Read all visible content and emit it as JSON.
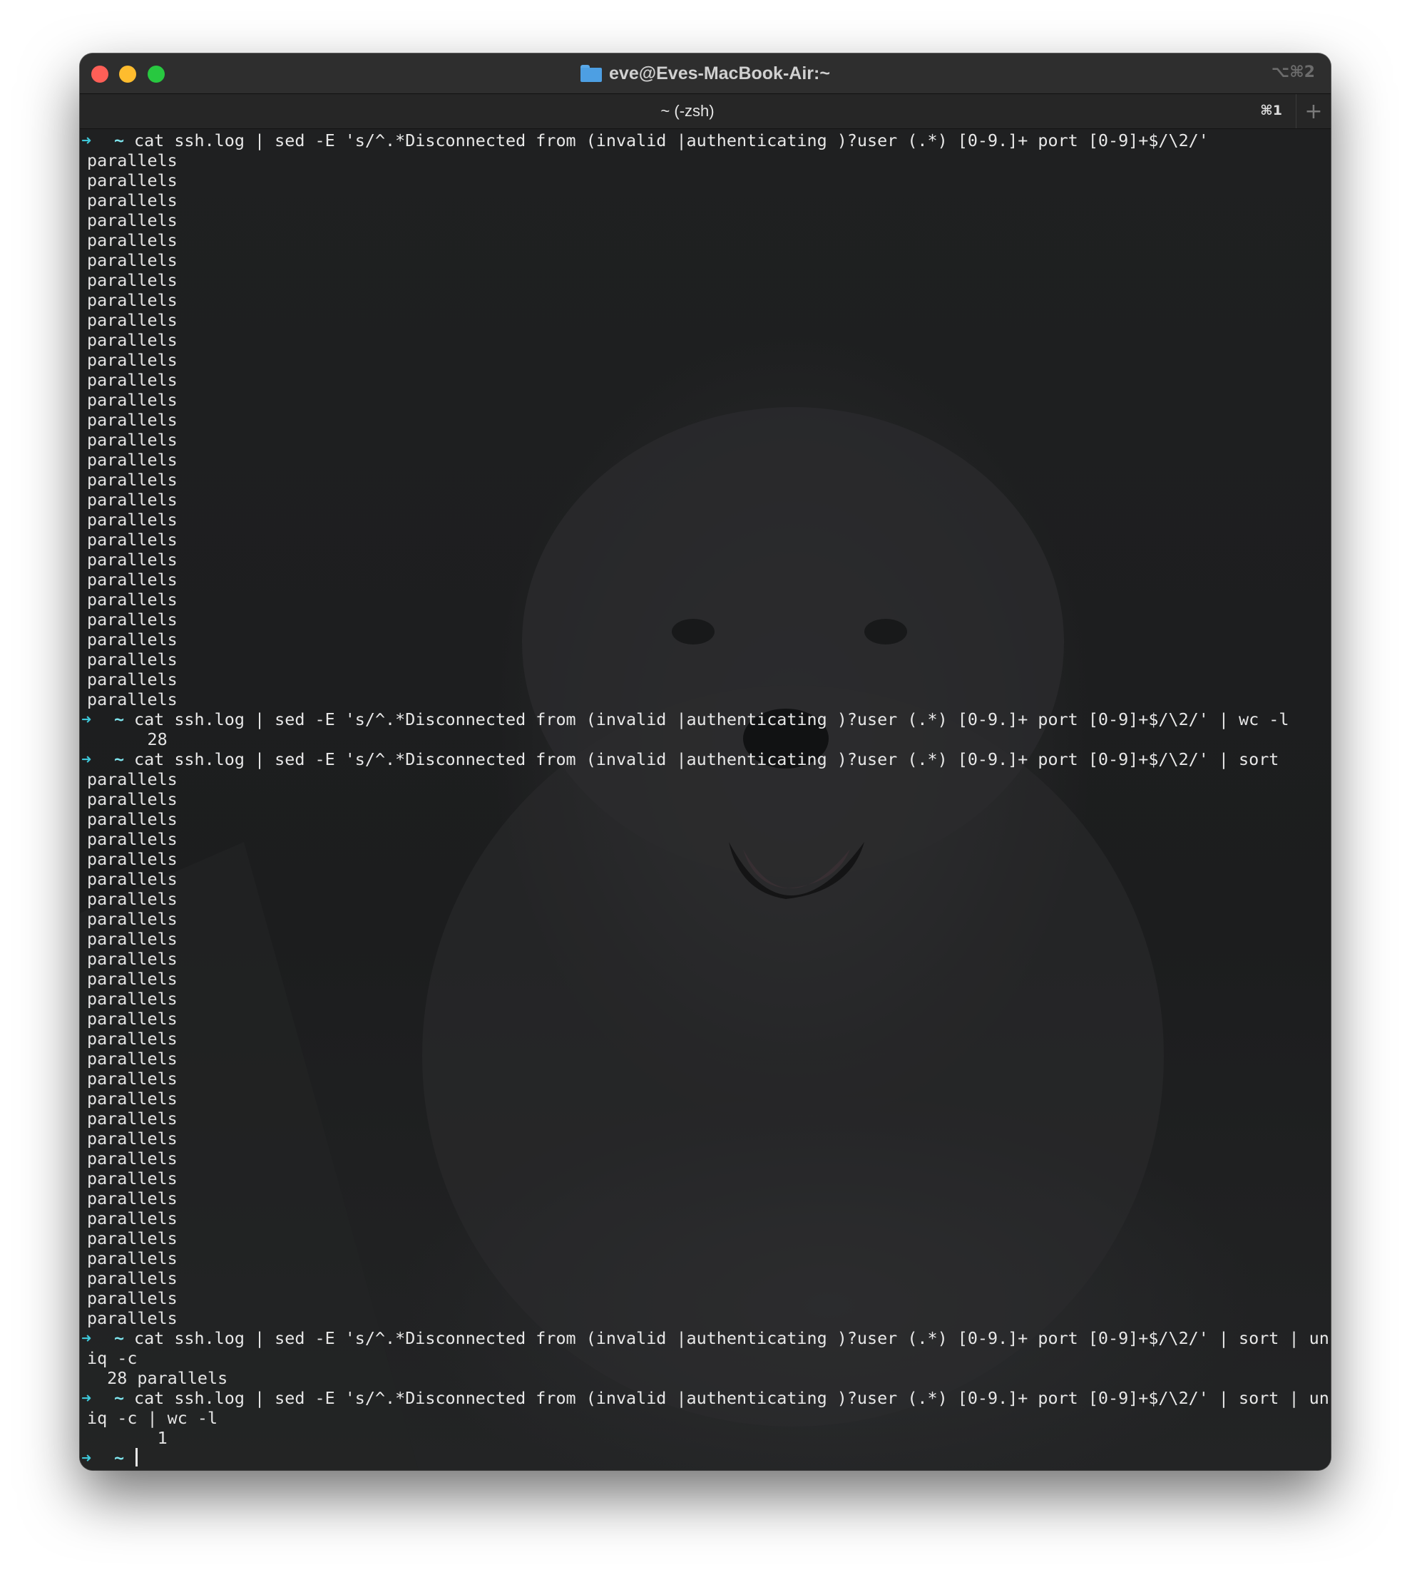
{
  "window": {
    "title": "eve@Eves-MacBook-Air:~",
    "title_icon": "folder-icon",
    "window_shortcut": "⌥⌘2",
    "tab_title": "~ (-zsh)",
    "tab_shortcut": "⌘1",
    "new_tab_icon": "plus-icon"
  },
  "colors": {
    "prompt_arrow": "#3ec7d8",
    "prompt_tilde": "#7ee3ec",
    "text": "#e4e4e4",
    "close": "#ff5f57",
    "minimize": "#febc2e",
    "zoom": "#28c840"
  },
  "prompt": {
    "arrow": "➜",
    "dir": "~"
  },
  "terminal": {
    "lines": [
      {
        "kind": "cmd",
        "text": "cat ssh.log | sed -E 's/^.*Disconnected from (invalid |authenticating )?user (.*) [0-9.]+ port [0-9]+$/\\2/'"
      },
      {
        "kind": "out",
        "text": "parallels"
      },
      {
        "kind": "out",
        "text": "parallels"
      },
      {
        "kind": "out",
        "text": "parallels"
      },
      {
        "kind": "out",
        "text": "parallels"
      },
      {
        "kind": "out",
        "text": "parallels"
      },
      {
        "kind": "out",
        "text": "parallels"
      },
      {
        "kind": "out",
        "text": "parallels"
      },
      {
        "kind": "out",
        "text": "parallels"
      },
      {
        "kind": "out",
        "text": "parallels"
      },
      {
        "kind": "out",
        "text": "parallels"
      },
      {
        "kind": "out",
        "text": "parallels"
      },
      {
        "kind": "out",
        "text": "parallels"
      },
      {
        "kind": "out",
        "text": "parallels"
      },
      {
        "kind": "out",
        "text": "parallels"
      },
      {
        "kind": "out",
        "text": "parallels"
      },
      {
        "kind": "out",
        "text": "parallels"
      },
      {
        "kind": "out",
        "text": "parallels"
      },
      {
        "kind": "out",
        "text": "parallels"
      },
      {
        "kind": "out",
        "text": "parallels"
      },
      {
        "kind": "out",
        "text": "parallels"
      },
      {
        "kind": "out",
        "text": "parallels"
      },
      {
        "kind": "out",
        "text": "parallels"
      },
      {
        "kind": "out",
        "text": "parallels"
      },
      {
        "kind": "out",
        "text": "parallels"
      },
      {
        "kind": "out",
        "text": "parallels"
      },
      {
        "kind": "out",
        "text": "parallels"
      },
      {
        "kind": "out",
        "text": "parallels"
      },
      {
        "kind": "out",
        "text": "parallels"
      },
      {
        "kind": "cmd",
        "text": "cat ssh.log | sed -E 's/^.*Disconnected from (invalid |authenticating )?user (.*) [0-9.]+ port [0-9]+$/\\2/' | wc -l"
      },
      {
        "kind": "out",
        "text": "      28"
      },
      {
        "kind": "cmd",
        "text": "cat ssh.log | sed -E 's/^.*Disconnected from (invalid |authenticating )?user (.*) [0-9.]+ port [0-9]+$/\\2/' | sort"
      },
      {
        "kind": "out",
        "text": "parallels"
      },
      {
        "kind": "out",
        "text": "parallels"
      },
      {
        "kind": "out",
        "text": "parallels"
      },
      {
        "kind": "out",
        "text": "parallels"
      },
      {
        "kind": "out",
        "text": "parallels"
      },
      {
        "kind": "out",
        "text": "parallels"
      },
      {
        "kind": "out",
        "text": "parallels"
      },
      {
        "kind": "out",
        "text": "parallels"
      },
      {
        "kind": "out",
        "text": "parallels"
      },
      {
        "kind": "out",
        "text": "parallels"
      },
      {
        "kind": "out",
        "text": "parallels"
      },
      {
        "kind": "out",
        "text": "parallels"
      },
      {
        "kind": "out",
        "text": "parallels"
      },
      {
        "kind": "out",
        "text": "parallels"
      },
      {
        "kind": "out",
        "text": "parallels"
      },
      {
        "kind": "out",
        "text": "parallels"
      },
      {
        "kind": "out",
        "text": "parallels"
      },
      {
        "kind": "out",
        "text": "parallels"
      },
      {
        "kind": "out",
        "text": "parallels"
      },
      {
        "kind": "out",
        "text": "parallels"
      },
      {
        "kind": "out",
        "text": "parallels"
      },
      {
        "kind": "out",
        "text": "parallels"
      },
      {
        "kind": "out",
        "text": "parallels"
      },
      {
        "kind": "out",
        "text": "parallels"
      },
      {
        "kind": "out",
        "text": "parallels"
      },
      {
        "kind": "out",
        "text": "parallels"
      },
      {
        "kind": "out",
        "text": "parallels"
      },
      {
        "kind": "out",
        "text": "parallels"
      },
      {
        "kind": "cmd",
        "text": "cat ssh.log | sed -E 's/^.*Disconnected from (invalid |authenticating )?user (.*) [0-9.]+ port [0-9]+$/\\2/' | sort | un"
      },
      {
        "kind": "out",
        "text": "iq -c"
      },
      {
        "kind": "out",
        "text": "  28 parallels"
      },
      {
        "kind": "cmd",
        "text": "cat ssh.log | sed -E 's/^.*Disconnected from (invalid |authenticating )?user (.*) [0-9.]+ port [0-9]+$/\\2/' | sort | un"
      },
      {
        "kind": "out",
        "text": "iq -c | wc -l"
      },
      {
        "kind": "out",
        "text": "       1"
      },
      {
        "kind": "prompt",
        "text": ""
      }
    ]
  }
}
